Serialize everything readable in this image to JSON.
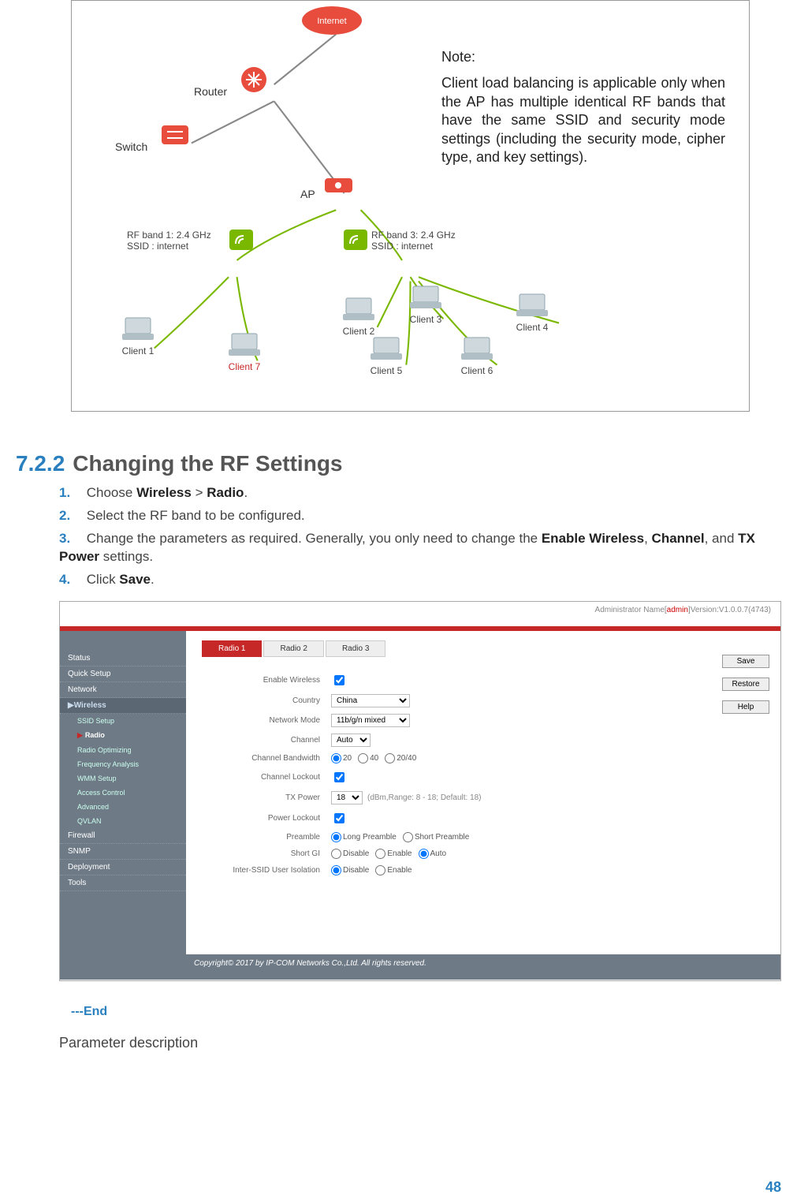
{
  "diagram": {
    "internet": "Internet",
    "router": "Router",
    "switch": "Switch",
    "ap": "AP",
    "rf1": "RF band 1: 2.4 GHz",
    "ssid1": "SSID : internet",
    "rf3": "RF band 3: 2.4 GHz",
    "ssid3": "SSID : internet",
    "client1": "Client 1",
    "client2": "Client 2",
    "client3": "Client 3",
    "client4": "Client 4",
    "client5": "Client 5",
    "client6": "Client 6",
    "client7": "Client 7",
    "note_title": "Note:",
    "note_body": "Client load balancing is applicable only when the AP has multiple identical RF bands that have the same SSID and security mode settings (including the security mode, cipher type, and key settings)."
  },
  "section": {
    "num": "7.2.2",
    "title": "Changing the RF Settings"
  },
  "steps": {
    "s1": {
      "num": "1.",
      "prefix": "Choose ",
      "b1": "Wireless",
      "mid": " > ",
      "b2": "Radio",
      "suffix": "."
    },
    "s2": {
      "num": "2.",
      "text": "Select the RF band to be configured."
    },
    "s3": {
      "num": "3.",
      "prefix": "Change the parameters as required. Generally, you only need to change the ",
      "b1": "Enable Wireless",
      "mid1": ", ",
      "b2": "Channel",
      "mid2": ", and ",
      "b3": "TX Power",
      "suffix": " settings."
    },
    "s4": {
      "num": "4.",
      "prefix": "Click ",
      "b1": "Save",
      "suffix": "."
    }
  },
  "admin": {
    "topbar_prefix": "Administrator Name[",
    "topbar_name": "admin",
    "topbar_suffix": "]Version:V1.0.0.7(4743)",
    "sidebar": {
      "status": "Status",
      "quick_setup": "Quick Setup",
      "network": "Network",
      "wireless": "Wireless",
      "ssid_setup": "SSID Setup",
      "radio": "Radio",
      "radio_opt": "Radio Optimizing",
      "freq": "Frequency Analysis",
      "wmm": "WMM Setup",
      "access": "Access Control",
      "advanced": "Advanced",
      "qvlan": "QVLAN",
      "firewall": "Firewall",
      "snmp": "SNMP",
      "deployment": "Deployment",
      "tools": "Tools"
    },
    "tabs": {
      "t1": "Radio 1",
      "t2": "Radio 2",
      "t3": "Radio 3"
    },
    "buttons": {
      "save": "Save",
      "restore": "Restore",
      "help": "Help"
    },
    "form": {
      "enable_wireless": "Enable Wireless",
      "country": "Country",
      "country_val": "China",
      "network_mode": "Network Mode",
      "network_mode_val": "11b/g/n mixed",
      "channel": "Channel",
      "channel_val": "Auto",
      "ch_bw": "Channel Bandwidth",
      "bw_20": "20",
      "bw_40": "40",
      "bw_2040": "20/40",
      "ch_lockout": "Channel Lockout",
      "tx_power": "TX Power",
      "tx_val": "18",
      "tx_note": "(dBm,Range: 8 - 18; Default: 18)",
      "pw_lockout": "Power Lockout",
      "preamble": "Preamble",
      "preamble_long": "Long Preamble",
      "preamble_short": "Short Preamble",
      "short_gi": "Short GI",
      "gi_disable": "Disable",
      "gi_enable": "Enable",
      "gi_auto": "Auto",
      "iso": "Inter-SSID User Isolation",
      "iso_disable": "Disable",
      "iso_enable": "Enable"
    },
    "footer": "Copyright© 2017 by IP-COM Networks Co.,Ltd. All rights reserved."
  },
  "end": "---End",
  "param_desc": "Parameter description",
  "page_number": "48"
}
